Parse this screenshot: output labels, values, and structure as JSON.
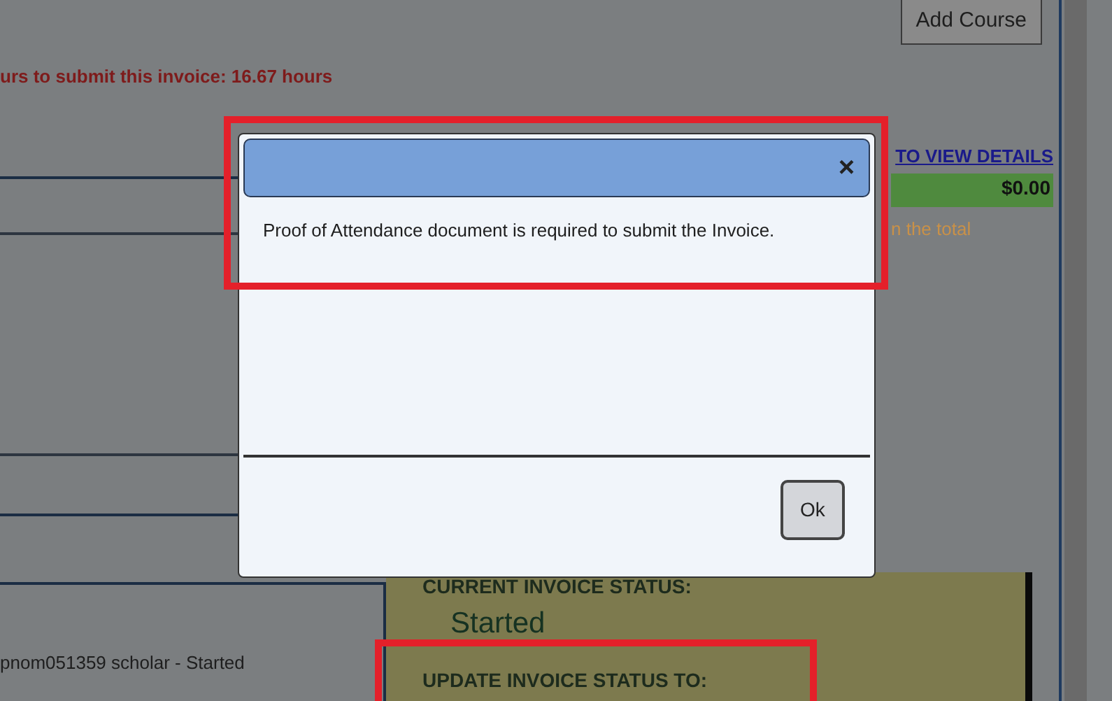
{
  "header": {
    "add_course_button": "Add Course",
    "hours_notice": "urs to submit this invoice: 16.67 hours"
  },
  "summary": {
    "details_link": "TO VIEW DETAILS",
    "total": "$0.00",
    "note": "n the total"
  },
  "scholar_row": "pnom051359 scholar - Started",
  "status_panel": {
    "current_label": "CURRENT INVOICE STATUS:",
    "current_value": "Started",
    "update_label": "UPDATE INVOICE STATUS TO:"
  },
  "dialog": {
    "close": "×",
    "message": "Proof of Attendance document is required to submit the Invoice.",
    "button": "Ok"
  }
}
